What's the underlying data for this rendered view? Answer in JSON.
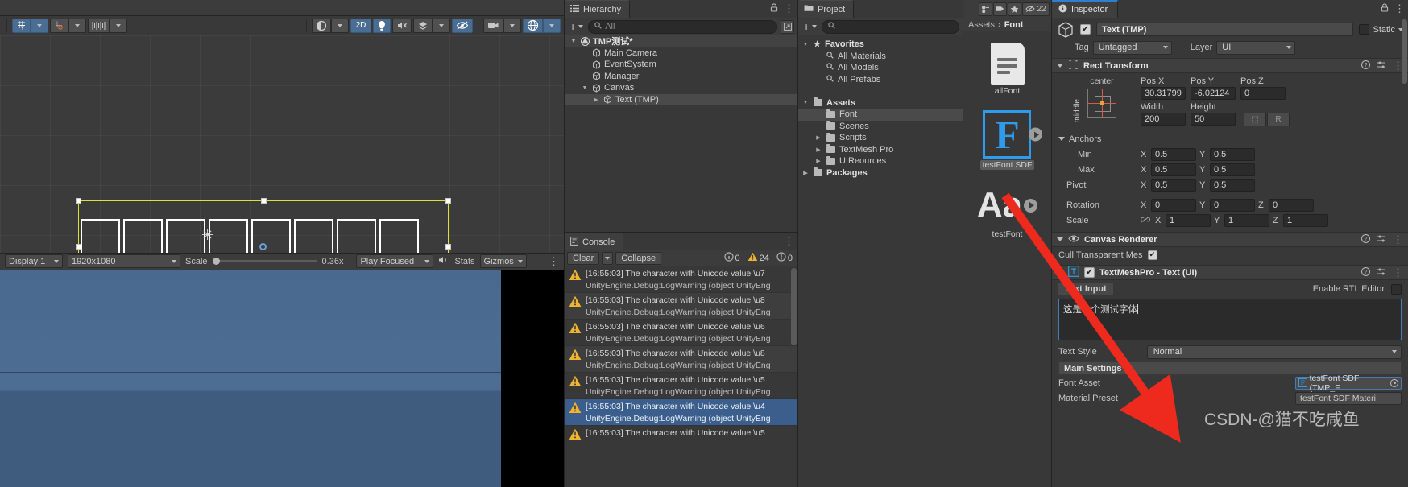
{
  "scene": {
    "toolbar": {
      "grid_snap_icon": "grid-snap-icon",
      "pivot_snap_icon": "pivot-snap-icon",
      "ruler_icon": "ruler-icon",
      "shading_icon": "shading-mode-icon",
      "mode_2d": "2D",
      "light_icon": "lighting-icon",
      "audio_icon": "audio-toggle-icon",
      "fx_icon": "effects-icon",
      "hidden_icon": "scene-visibility-icon",
      "camera_icon": "camera-icon",
      "gizmos_icon": "gizmos-icon"
    },
    "glyph_boxes": 8,
    "cursor_icon": "text-cursor-icon"
  },
  "game": {
    "display_label": "Display 1",
    "resolution": "1920x1080",
    "scale_label": "Scale",
    "scale_value": "0.36x",
    "play_focused": "Play Focused",
    "mute_icon": "mute-audio-icon",
    "stats": "Stats",
    "gizmos": "Gizmos"
  },
  "hierarchy": {
    "tab_label": "Hierarchy",
    "tab_icon": "hierarchy-icon",
    "add_label": "+",
    "search_placeholder": "All",
    "search_icon": "search-icon",
    "lock_icon": "lock-icon",
    "kebab_icon": "kebab-menu-icon",
    "expand_icon": "expand-icon",
    "items": [
      {
        "label": "TMP测试*",
        "depth": 0,
        "icon": "unity-scene-icon",
        "expanded": true,
        "selected": false,
        "is_scene": true
      },
      {
        "label": "Main Camera",
        "depth": 1,
        "icon": "gameobject-icon",
        "expanded": false,
        "selected": false,
        "is_scene": false
      },
      {
        "label": "EventSystem",
        "depth": 1,
        "icon": "gameobject-icon",
        "expanded": false,
        "selected": false,
        "is_scene": false
      },
      {
        "label": "Manager",
        "depth": 1,
        "icon": "gameobject-icon",
        "expanded": false,
        "selected": false,
        "is_scene": false
      },
      {
        "label": "Canvas",
        "depth": 1,
        "icon": "gameobject-icon",
        "expanded": true,
        "selected": false,
        "is_scene": false
      },
      {
        "label": "Text (TMP)",
        "depth": 2,
        "icon": "gameobject-icon",
        "expanded": false,
        "selected": true,
        "is_scene": false
      }
    ]
  },
  "console": {
    "tab_label": "Console",
    "tab_icon": "console-icon",
    "clear_label": "Clear",
    "collapse_label": "Collapse",
    "kebab_icon": "kebab-menu-icon",
    "counts": {
      "log": "0",
      "warning": "24",
      "error": "0"
    },
    "entries": [
      {
        "line1": "[16:55:03] The character with Unicode value \\u7",
        "line2": "UnityEngine.Debug:LogWarning (object,UnityEng",
        "icon": "warning-icon",
        "selected": false
      },
      {
        "line1": "[16:55:03] The character with Unicode value \\u8",
        "line2": "UnityEngine.Debug:LogWarning (object,UnityEng",
        "icon": "warning-icon",
        "selected": false
      },
      {
        "line1": "[16:55:03] The character with Unicode value \\u6",
        "line2": "UnityEngine.Debug:LogWarning (object,UnityEng",
        "icon": "warning-icon",
        "selected": false
      },
      {
        "line1": "[16:55:03] The character with Unicode value \\u8",
        "line2": "UnityEngine.Debug:LogWarning (object,UnityEng",
        "icon": "warning-icon",
        "selected": false
      },
      {
        "line1": "[16:55:03] The character with Unicode value \\u5",
        "line2": "UnityEngine.Debug:LogWarning (object,UnityEng",
        "icon": "warning-icon",
        "selected": false
      },
      {
        "line1": "[16:55:03] The character with Unicode value \\u4",
        "line2": "UnityEngine.Debug:LogWarning (object,UnityEng",
        "icon": "warning-icon",
        "selected": true
      },
      {
        "line1": "[16:55:03] The character with Unicode value \\u5",
        "line2": "",
        "icon": "warning-icon",
        "selected": false
      }
    ]
  },
  "project": {
    "tab_label": "Project",
    "tab_icon": "project-folder-icon",
    "add_label": "+",
    "search_placeholder": "",
    "search_icon": "search-icon",
    "lock_icon": "lock-icon",
    "kebab_icon": "kebab-menu-icon",
    "tree": [
      {
        "label": "Favorites",
        "depth": 0,
        "icon": "star-icon",
        "arrow": "down",
        "selected": false,
        "bold": true
      },
      {
        "label": "All Materials",
        "depth": 1,
        "icon": "search-icon",
        "arrow": "",
        "selected": false,
        "bold": false
      },
      {
        "label": "All Models",
        "depth": 1,
        "icon": "search-icon",
        "arrow": "",
        "selected": false,
        "bold": false
      },
      {
        "label": "All Prefabs",
        "depth": 1,
        "icon": "search-icon",
        "arrow": "",
        "selected": false,
        "bold": false
      },
      {
        "label": "",
        "depth": 0,
        "icon": "",
        "arrow": "",
        "selected": false,
        "bold": false
      },
      {
        "label": "Assets",
        "depth": 0,
        "icon": "folder-open-icon",
        "arrow": "down",
        "selected": false,
        "bold": true
      },
      {
        "label": "Font",
        "depth": 1,
        "icon": "folder-icon",
        "arrow": "",
        "selected": true,
        "bold": false
      },
      {
        "label": "Scenes",
        "depth": 1,
        "icon": "folder-icon",
        "arrow": "",
        "selected": false,
        "bold": false
      },
      {
        "label": "Scripts",
        "depth": 1,
        "icon": "folder-icon",
        "arrow": "right",
        "selected": false,
        "bold": false
      },
      {
        "label": "TextMesh Pro",
        "depth": 1,
        "icon": "folder-icon",
        "arrow": "right",
        "selected": false,
        "bold": false
      },
      {
        "label": "UIReources",
        "depth": 1,
        "icon": "folder-icon",
        "arrow": "right",
        "selected": false,
        "bold": false
      },
      {
        "label": "Packages",
        "depth": 0,
        "icon": "folder-open-icon",
        "arrow": "right",
        "selected": false,
        "bold": true
      }
    ]
  },
  "assets": {
    "breadcrumb_root": "Assets",
    "breadcrumb_sep": "›",
    "breadcrumb_current": "Font",
    "badge_count": "22",
    "toolbar_icons": [
      "asset-filter-icon",
      "label-icon",
      "favorite-star-icon",
      "visibility-icon"
    ],
    "items": [
      {
        "label": "allFont",
        "icon": "text-document-icon",
        "selected": false,
        "has_expand": false
      },
      {
        "label": "testFont SDF",
        "icon": "font-asset-icon",
        "glyph": "F",
        "selected": true,
        "has_expand": true
      },
      {
        "label": "testFont",
        "icon": "font-file-icon",
        "glyph": "Aa",
        "selected": false,
        "has_expand": true
      }
    ]
  },
  "inspector": {
    "tab_label": "Inspector",
    "tab_icon": "info-icon",
    "lock_icon": "lock-icon",
    "kebab_icon": "kebab-menu-icon",
    "gameobject": {
      "enabled": true,
      "name": "Text (TMP)",
      "static_label": "Static",
      "tag_label": "Tag",
      "tag_value": "Untagged",
      "layer_label": "Layer",
      "layer_value": "UI",
      "cube_icon": "gameobject-cube-icon"
    },
    "rect_transform": {
      "title": "Rect Transform",
      "icon": "rect-transform-icon",
      "help_icon": "help-icon",
      "preset_icon": "preset-icon",
      "kebab_icon": "kebab-menu-icon",
      "anchor_h": "center",
      "anchor_v": "middle",
      "pos_x_label": "Pos X",
      "pos_x": "30.31799",
      "pos_y_label": "Pos Y",
      "pos_y": "-6.02124",
      "pos_z_label": "Pos Z",
      "pos_z": "0",
      "width_label": "Width",
      "width": "200",
      "height_label": "Height",
      "height": "50",
      "blueprint_icon": "blueprint-mode-icon",
      "raw_label": "R",
      "anchors_label": "Anchors",
      "min_label": "Min",
      "min_x": "0.5",
      "min_y": "0.5",
      "max_label": "Max",
      "max_x": "0.5",
      "max_y": "0.5",
      "pivot_label": "Pivot",
      "pivot_x": "0.5",
      "pivot_y": "0.5",
      "rotation_label": "Rotation",
      "rot_x": "0",
      "rot_y": "0",
      "rot_z": "0",
      "scale_label": "Scale",
      "scale_x": "1",
      "scale_y": "1",
      "scale_z": "1",
      "scale_link_icon": "link-off-icon",
      "axis_x": "X",
      "axis_y": "Y",
      "axis_z": "Z"
    },
    "canvas_renderer": {
      "title": "Canvas Renderer",
      "icon": "eye-icon",
      "help_icon": "help-icon",
      "preset_icon": "preset-icon",
      "kebab_icon": "kebab-menu-icon",
      "cull_label": "Cull Transparent Mes",
      "cull_checked": true
    },
    "tmp": {
      "title": "TextMeshPro - Text (UI)",
      "icon": "tmp-icon",
      "enabled": true,
      "help_icon": "help-icon",
      "preset_icon": "preset-icon",
      "kebab_icon": "kebab-menu-icon",
      "text_input_label": "Text Input",
      "rtl_label": "Enable RTL Editor",
      "rtl_checked": false,
      "text_value": "这是一个测试字体",
      "text_style_label": "Text Style",
      "text_style_value": "Normal",
      "main_settings_label": "Main Settings",
      "font_asset_label": "Font Asset",
      "font_asset_value": "testFont SDF (TMP_F",
      "material_preset_label": "Material Preset",
      "material_preset_value": "testFont SDF  Materi"
    }
  },
  "watermark": "CSDN-@猫不吃咸鱼",
  "colors": {
    "accent_blue": "#2f9bea",
    "selection_blue": "#3b5e8c",
    "warning_yellow": "#f0b431",
    "arrow_red": "#ee2a1e",
    "yellow_outline": "#dede3c"
  }
}
